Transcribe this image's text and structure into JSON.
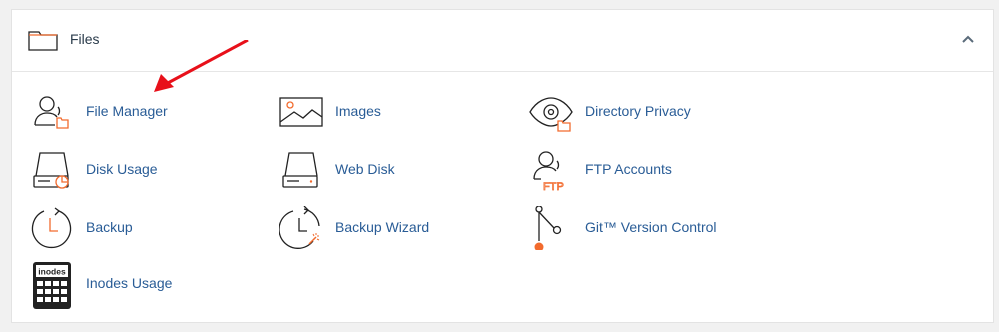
{
  "section": {
    "title": "Files",
    "header_icon": "folder-icon",
    "collapse_icon": "chevron-up-icon"
  },
  "items": [
    {
      "label": "File Manager",
      "icon": "file-manager-icon"
    },
    {
      "label": "Images",
      "icon": "images-icon"
    },
    {
      "label": "Directory Privacy",
      "icon": "directory-privacy-icon"
    },
    {
      "label": "Disk Usage",
      "icon": "disk-usage-icon"
    },
    {
      "label": "Web Disk",
      "icon": "web-disk-icon"
    },
    {
      "label": "FTP Accounts",
      "icon": "ftp-accounts-icon",
      "icon_text": "FTP"
    },
    {
      "label": "Backup",
      "icon": "backup-icon"
    },
    {
      "label": "Backup Wizard",
      "icon": "backup-wizard-icon"
    },
    {
      "label": "Git™ Version Control",
      "icon": "git-version-control-icon"
    },
    {
      "label": "Inodes Usage",
      "icon": "inodes-usage-icon",
      "icon_text": "inodes"
    }
  ],
  "colors": {
    "accent": "#f26b2e",
    "link": "#295c96",
    "icon_stroke": "#222222",
    "annotation_arrow": "#e8101a"
  }
}
